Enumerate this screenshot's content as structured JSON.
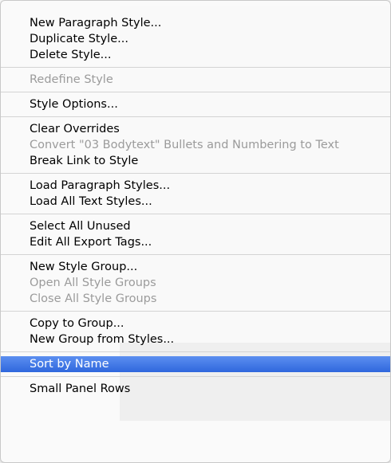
{
  "menu": {
    "groups": [
      {
        "items": [
          {
            "label": "New Paragraph Style...",
            "disabled": false
          },
          {
            "label": "Duplicate Style...",
            "disabled": false
          },
          {
            "label": "Delete Style...",
            "disabled": false
          }
        ]
      },
      {
        "items": [
          {
            "label": "Redefine Style",
            "disabled": true
          }
        ]
      },
      {
        "items": [
          {
            "label": "Style Options...",
            "disabled": false
          }
        ]
      },
      {
        "items": [
          {
            "label": "Clear Overrides",
            "disabled": false
          },
          {
            "label": "Convert \"03 Bodytext\" Bullets and Numbering to Text",
            "disabled": true
          },
          {
            "label": "Break Link to Style",
            "disabled": false
          }
        ]
      },
      {
        "items": [
          {
            "label": "Load Paragraph Styles...",
            "disabled": false
          },
          {
            "label": "Load All Text Styles...",
            "disabled": false
          }
        ]
      },
      {
        "items": [
          {
            "label": "Select All Unused",
            "disabled": false
          },
          {
            "label": "Edit All Export Tags...",
            "disabled": false
          }
        ]
      },
      {
        "items": [
          {
            "label": "New Style Group...",
            "disabled": false
          },
          {
            "label": "Open All Style Groups",
            "disabled": true
          },
          {
            "label": "Close All Style Groups",
            "disabled": true
          }
        ]
      },
      {
        "items": [
          {
            "label": "Copy to Group...",
            "disabled": false
          },
          {
            "label": "New Group from Styles...",
            "disabled": false
          }
        ]
      },
      {
        "items": [
          {
            "label": "Sort by Name",
            "disabled": false,
            "highlighted": true
          }
        ]
      },
      {
        "items": [
          {
            "label": "Small Panel Rows",
            "disabled": false
          }
        ]
      }
    ],
    "highlight_color": "#3875d7",
    "disabled_color": "#9b9b9b"
  }
}
